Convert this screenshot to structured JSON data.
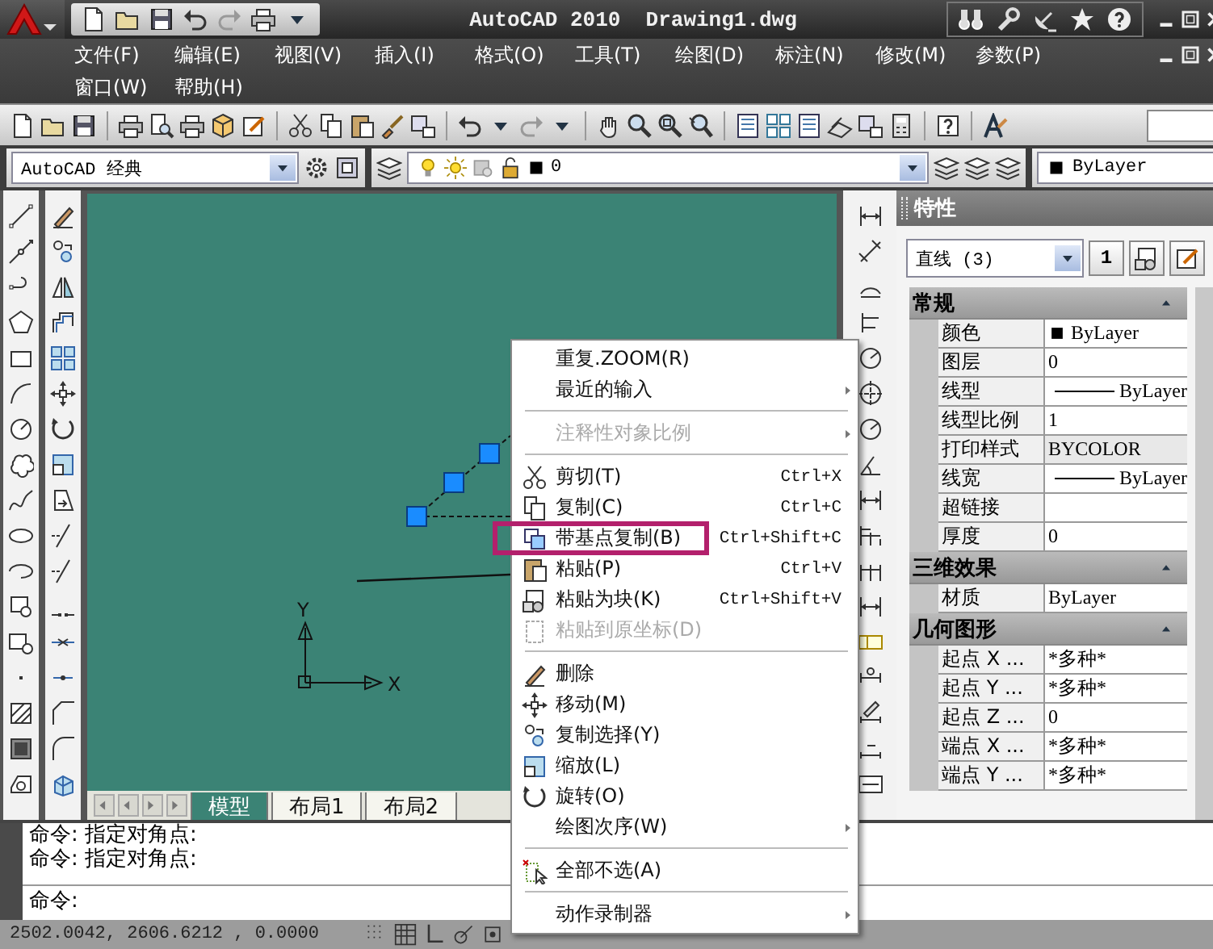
{
  "title_bar": {
    "title": "AutoCAD 2010  Drawing1.dwg"
  },
  "menu_bar": {
    "items": [
      "文件(F)",
      "编辑(E)",
      "视图(V)",
      "插入(I)",
      "格式(O)",
      "工具(T)",
      "绘图(D)",
      "标注(N)",
      "修改(M)",
      "参数(P)",
      "窗口(W)",
      "帮助(H)"
    ]
  },
  "workspace_toolbar": {
    "workspace": "AutoCAD 经典",
    "layer": "0",
    "object_color_setting": "ByLayer"
  },
  "drawing_area": {
    "ucs": {
      "x_label": "X",
      "y_label": "Y"
    },
    "layout_tabs": [
      {
        "label": "模型",
        "selected": true
      },
      {
        "label": "布局1",
        "selected": false
      },
      {
        "label": "布局2",
        "selected": false
      }
    ]
  },
  "context_menu": {
    "items": [
      {
        "kind": "item",
        "label": "重复.ZOOM(R)",
        "disabled": false,
        "submenu": false
      },
      {
        "kind": "item",
        "label": "最近的输入",
        "disabled": false,
        "submenu": true
      },
      {
        "kind": "separator"
      },
      {
        "kind": "item",
        "label": "注释性对象比例",
        "disabled": true,
        "submenu": true
      },
      {
        "kind": "separator"
      },
      {
        "kind": "item",
        "label": "剪切(T)",
        "shortcut": "Ctrl+X",
        "disabled": false,
        "submenu": false
      },
      {
        "kind": "item",
        "label": "复制(C)",
        "shortcut": "Ctrl+C",
        "disabled": false,
        "submenu": false
      },
      {
        "kind": "item",
        "label": "带基点复制(B)",
        "shortcut": "Ctrl+Shift+C",
        "disabled": false,
        "submenu": false,
        "highlighted": true
      },
      {
        "kind": "item",
        "label": "粘贴(P)",
        "shortcut": "Ctrl+V",
        "disabled": false,
        "submenu": false
      },
      {
        "kind": "item",
        "label": "粘贴为块(K)",
        "shortcut": "Ctrl+Shift+V",
        "disabled": false,
        "submenu": false
      },
      {
        "kind": "item",
        "label": "粘贴到原坐标(D)",
        "disabled": true,
        "submenu": false
      },
      {
        "kind": "separator"
      },
      {
        "kind": "item",
        "label": "删除",
        "disabled": false,
        "submenu": false
      },
      {
        "kind": "item",
        "label": "移动(M)",
        "disabled": false,
        "submenu": false
      },
      {
        "kind": "item",
        "label": "复制选择(Y)",
        "disabled": false,
        "submenu": false
      },
      {
        "kind": "item",
        "label": "缩放(L)",
        "disabled": false,
        "submenu": false
      },
      {
        "kind": "item",
        "label": "旋转(O)",
        "disabled": false,
        "submenu": false
      },
      {
        "kind": "item",
        "label": "绘图次序(W)",
        "disabled": false,
        "submenu": true
      },
      {
        "kind": "separator"
      },
      {
        "kind": "item",
        "label": "全部不选(A)",
        "disabled": false,
        "submenu": false
      },
      {
        "kind": "separator"
      },
      {
        "kind": "item",
        "label": "动作录制器",
        "disabled": false,
        "submenu": true
      }
    ]
  },
  "properties": {
    "title": "特性",
    "selection": "直线 (3)",
    "pickadd": "1",
    "sections": [
      {
        "title": "常规",
        "expanded": true,
        "rows": [
          {
            "label": "颜色",
            "value": "ByLayer",
            "kind": "color"
          },
          {
            "label": "图层",
            "value": "0",
            "kind": "text"
          },
          {
            "label": "线型",
            "value": "ByLayer",
            "kind": "line"
          },
          {
            "label": "线型比例",
            "value": "1",
            "kind": "text"
          },
          {
            "label": "打印样式",
            "value": "BYCOLOR",
            "kind": "readonly"
          },
          {
            "label": "线宽",
            "value": "ByLayer",
            "kind": "line"
          },
          {
            "label": "超链接",
            "kind": "text"
          },
          {
            "label": "厚度",
            "value": "0",
            "kind": "text"
          }
        ]
      },
      {
        "title": "三维效果",
        "expanded": true,
        "rows": [
          {
            "label": "材质",
            "value": "ByLayer",
            "kind": "text"
          }
        ]
      },
      {
        "title": "几何图形",
        "expanded": true,
        "rows": [
          {
            "label": "起点 X ...",
            "value": "*多种*",
            "kind": "text"
          },
          {
            "label": "起点 Y ...",
            "value": "*多种*",
            "kind": "text"
          },
          {
            "label": "起点 Z ...",
            "value": "0",
            "kind": "text"
          },
          {
            "label": "端点 X ...",
            "value": "*多种*",
            "kind": "text"
          },
          {
            "label": "端点 Y ...",
            "value": "*多种*",
            "kind": "text"
          }
        ]
      }
    ]
  },
  "command_line": {
    "history": [
      "命令: 指定对角点:",
      "命令: 指定对角点:"
    ],
    "prompt": "命令:"
  },
  "status_bar": {
    "coordinates": "2502.0042, 2606.6212 , 0.0000"
  }
}
